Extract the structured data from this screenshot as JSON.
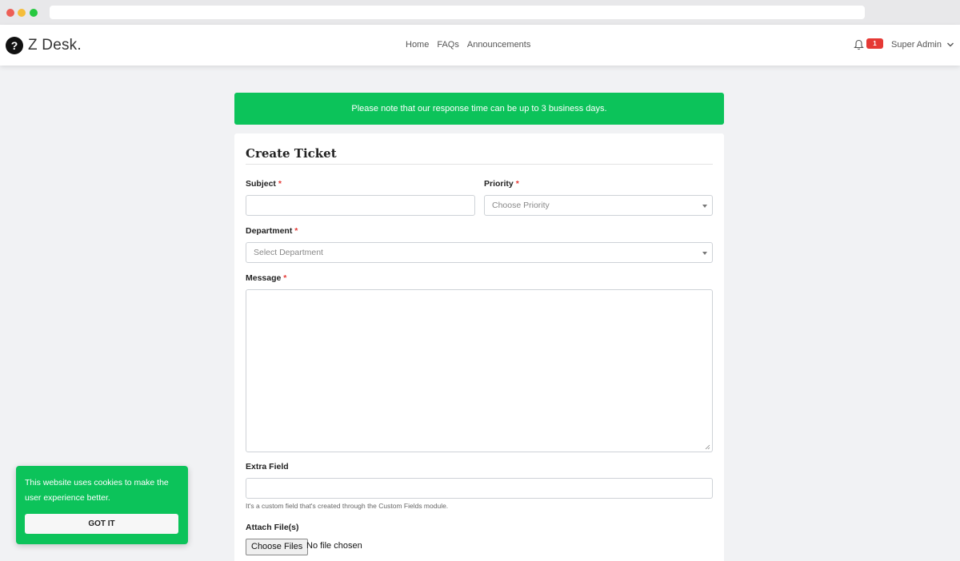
{
  "brand": {
    "logo_glyph": "?",
    "name": "Z Desk."
  },
  "nav": {
    "links": [
      "Home",
      "FAQs",
      "Announcements"
    ]
  },
  "header": {
    "notification_count": "1",
    "user_label": "Super Admin"
  },
  "notice": {
    "text": "Please note that our response time can be up to 3 business days.",
    "color": "#0cc35a"
  },
  "form": {
    "title": "Create Ticket",
    "required_mark": "*",
    "subject": {
      "label": "Subject",
      "value": ""
    },
    "priority": {
      "label": "Priority",
      "placeholder": "Choose Priority"
    },
    "department": {
      "label": "Department",
      "placeholder": "Select Department"
    },
    "message": {
      "label": "Message",
      "value": ""
    },
    "extra_field": {
      "label": "Extra Field",
      "help": "It's a custom field that's created through the Custom Fields module.",
      "value": ""
    },
    "attach": {
      "label": "Attach File(s)",
      "button": "Choose Files",
      "status": "No file chosen"
    }
  },
  "cookie": {
    "text": "This website uses cookies to make the user experience better.",
    "button": "GOT IT"
  },
  "colors": {
    "accent_green": "#0cc35a",
    "badge_red": "#e53935"
  },
  "icons": [
    "question-icon",
    "bell-icon",
    "chevron-down-icon"
  ]
}
